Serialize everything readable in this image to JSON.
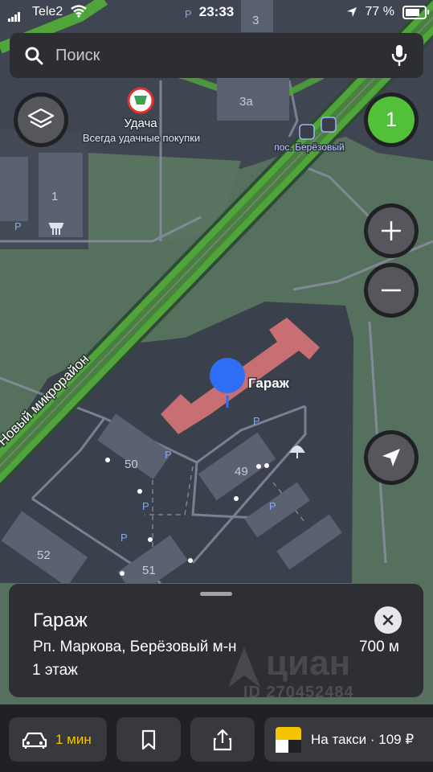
{
  "status_bar": {
    "carrier": "Tele2",
    "time": "23:33",
    "battery_percent": "77 %",
    "battery_level": 0.77
  },
  "search": {
    "placeholder": "Поиск"
  },
  "map": {
    "badge_count": "1",
    "poi": {
      "name": "Удача",
      "tagline": "Всегда удачные покупки"
    },
    "bus_stop": "пос. Берёзовый",
    "street": "Новый микрорайон",
    "marker_label": "Гараж",
    "buildings": [
      "3",
      "3а",
      "1",
      "50",
      "49",
      "52",
      "51"
    ],
    "parking_label": "P"
  },
  "place_card": {
    "title": "Гараж",
    "address": "Рп. Маркова, Берёзовый м-н",
    "distance": "700 м",
    "floor": "1 этаж",
    "watermark": "циан",
    "watermark_id": "ID 270452484"
  },
  "bottom_bar": {
    "route_eta": "1 мин",
    "taxi_label": "На такси · 109 ₽"
  },
  "colors": {
    "road_green": "#52c038",
    "accent_yellow": "#f3c400",
    "marker_blue": "#2f6ef4",
    "garage_red": "#e07879"
  },
  "icons": [
    "signal-icon",
    "wifi-icon",
    "location-arrow-icon",
    "battery-icon",
    "search-icon",
    "microphone-icon",
    "layers-icon",
    "plus-icon",
    "minus-icon",
    "navigate-icon",
    "close-icon",
    "car-icon",
    "bookmark-icon",
    "share-icon",
    "yandex-taxi-icon"
  ]
}
